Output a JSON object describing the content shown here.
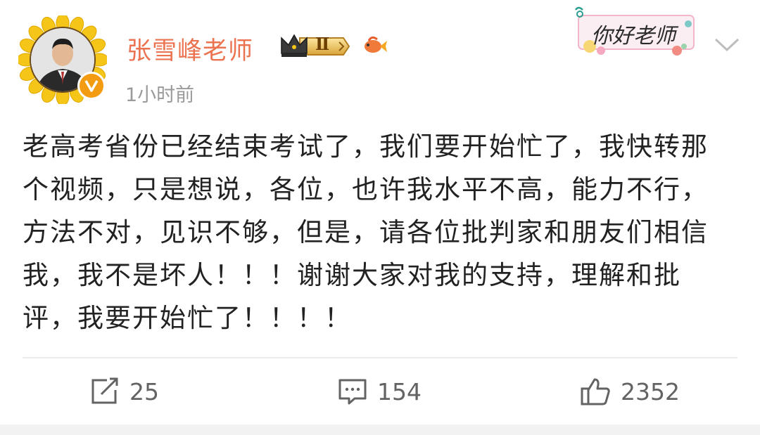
{
  "post": {
    "author": "张雪峰老师",
    "time": "1小时前",
    "badge_level": "Ⅱ",
    "sticker_text": "你好老师",
    "text": "老高考省份已经结束考试了，我们要开始忙了，我快转那个视频，只是想说，各位，也许我水平不高，能力不行，方法不对，见识不够，但是，请各位批判家和朋友们相信我，我不是坏人！！！谢谢大家对我的支持，理解和批评，我要开始忙了！！！！"
  },
  "actions": {
    "repost_count": "25",
    "comment_count": "154",
    "like_count": "2352"
  },
  "icons": [
    "sunflower-frame-icon",
    "verified-icon",
    "crown-badge-icon",
    "fish-icon",
    "chevron-down-icon",
    "repost-icon",
    "comment-icon",
    "like-icon"
  ],
  "colors": {
    "username": "#eb7350",
    "verified": "#f39c12",
    "text": "#222222",
    "meta": "#9a9a9a"
  }
}
